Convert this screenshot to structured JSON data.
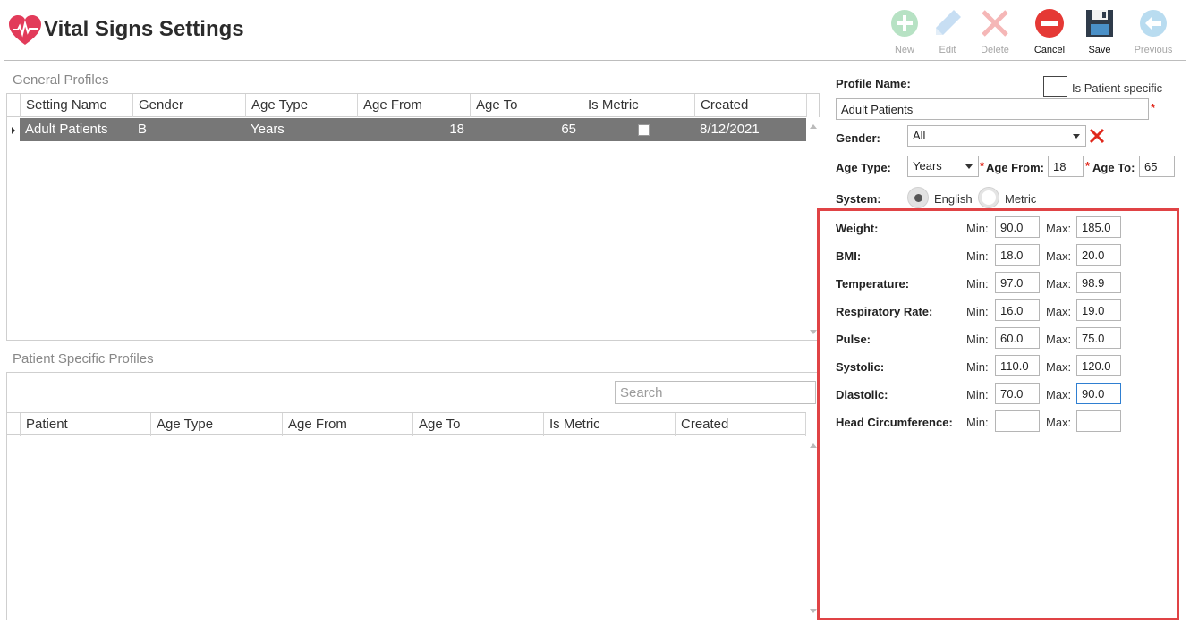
{
  "app": {
    "title": "Vital Signs Settings",
    "brand_color": "#e23b5a"
  },
  "toolbar": [
    {
      "label": "New",
      "icon": "plus-circle-icon",
      "enabled": false
    },
    {
      "label": "Edit",
      "icon": "pencil-icon",
      "enabled": false
    },
    {
      "label": "Delete",
      "icon": "x-icon",
      "enabled": false
    },
    {
      "label": "Cancel",
      "icon": "minus-circle-icon",
      "enabled": true
    },
    {
      "label": "Save",
      "icon": "floppy-disk-icon",
      "enabled": true
    },
    {
      "label": "Previous",
      "icon": "back-arrow-icon",
      "enabled": false
    }
  ],
  "general_profiles": {
    "title": "General Profiles",
    "columns": [
      "Setting Name",
      "Gender",
      "Age Type",
      "Age From",
      "Age To",
      "Is Metric",
      "Created"
    ],
    "rows": [
      {
        "setting_name": "Adult Patients",
        "gender": "B",
        "age_type": "Years",
        "age_from": "18",
        "age_to": "65",
        "is_metric": false,
        "created": "8/12/2021"
      }
    ]
  },
  "patient_profiles": {
    "title": "Patient Specific Profiles",
    "search_placeholder": "Search",
    "columns": [
      "Patient",
      "Age Type",
      "Age From",
      "Age To",
      "Is Metric",
      "Created"
    ]
  },
  "form": {
    "profile_name_label": "Profile Name:",
    "is_patient_specific_label": "Is Patient specific",
    "profile_name_value": "Adult Patients",
    "gender_label": "Gender:",
    "gender_value": "All",
    "age_type_label": "Age Type:",
    "age_type_value": "Years",
    "age_from_label": "Age From:",
    "age_from_value": "18",
    "age_to_label": "Age To:",
    "age_to_value": "65",
    "system_label": "System:",
    "system_options": [
      "English",
      "Metric"
    ],
    "system_selected": "English",
    "min_label": "Min:",
    "max_label": "Max:",
    "vitals": [
      {
        "label": "Weight:",
        "min": "90.0",
        "max": "185.0"
      },
      {
        "label": "BMI:",
        "min": "18.0",
        "max": "20.0"
      },
      {
        "label": "Temperature:",
        "min": "97.0",
        "max": "98.9"
      },
      {
        "label": "Respiratory Rate:",
        "min": "16.0",
        "max": "19.0"
      },
      {
        "label": "Pulse:",
        "min": "60.0",
        "max": "75.0"
      },
      {
        "label": "Systolic:",
        "min": "110.0",
        "max": "120.0"
      },
      {
        "label": "Diastolic:",
        "min": "70.0",
        "max": "90.0"
      },
      {
        "label": "Head Circumference:",
        "min": "",
        "max": ""
      }
    ],
    "highlight_color": "#e04345"
  }
}
